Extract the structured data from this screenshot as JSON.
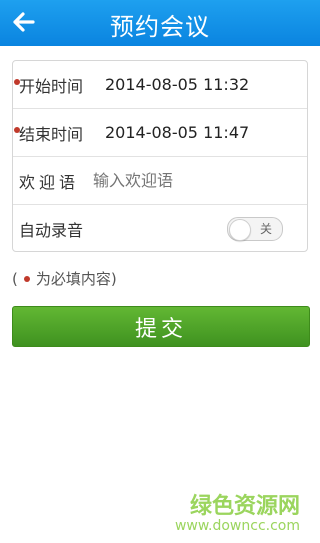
{
  "header": {
    "title": "预约会议",
    "back_icon": "arrow-left-icon"
  },
  "form": {
    "start_time": {
      "label": "开始时间",
      "value": "2014-08-05 11:32"
    },
    "end_time": {
      "label": "结束时间",
      "value": "2014-08-05 11:47"
    },
    "welcome": {
      "label": "欢迎语",
      "placeholder": "输入欢迎语"
    },
    "auto_record": {
      "label": "自动录音",
      "toggle_text": "关"
    }
  },
  "note": {
    "open": "(",
    "text": "为必填内容)"
  },
  "submit": {
    "label": "提交"
  },
  "watermark": {
    "brand": "绿色资源网",
    "url": "www.downcc.com"
  },
  "colors": {
    "header": "#1592e6",
    "submit": "#4a9e28",
    "required": "#c0392b"
  }
}
